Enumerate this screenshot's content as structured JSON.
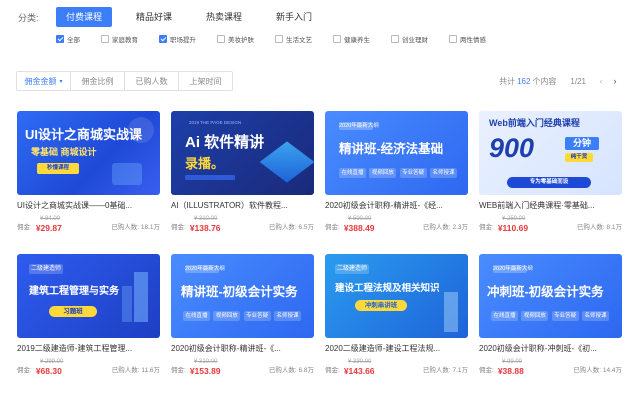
{
  "filters": {
    "category_label": "分类:",
    "tabs": [
      {
        "label": "付费课程",
        "active": true
      },
      {
        "label": "精品好课",
        "active": false
      },
      {
        "label": "热卖课程",
        "active": false
      },
      {
        "label": "新手入门",
        "active": false
      }
    ],
    "subcategories": [
      {
        "label": "全部",
        "checked": true
      },
      {
        "label": "家庭教育",
        "checked": false
      },
      {
        "label": "职场提升",
        "checked": true
      },
      {
        "label": "美妆护肤",
        "checked": false
      },
      {
        "label": "生活文艺",
        "checked": false
      },
      {
        "label": "健康养生",
        "checked": false
      },
      {
        "label": "创业理财",
        "checked": false
      },
      {
        "label": "两性情感",
        "checked": false
      }
    ]
  },
  "sort": {
    "options": [
      {
        "label": "佣金金额",
        "arrow": "▾",
        "active": true
      },
      {
        "label": "佣金比例",
        "arrow": "",
        "active": false
      },
      {
        "label": "已购人数",
        "arrow": "",
        "active": false
      },
      {
        "label": "上架时间",
        "arrow": "",
        "active": false
      }
    ],
    "total_prefix": "共计",
    "total_count": "162",
    "total_suffix": "个内容",
    "page": "1/21",
    "prev_icon": "‹",
    "next_icon": "›"
  },
  "labels": {
    "commission": "佣金:",
    "buyers_prefix": "已购人数:"
  },
  "cards": [
    {
      "title": "UI设计之商城实战课——0基础...",
      "orig_price": "¥ 84.00",
      "commission": "¥29.87",
      "buyers": "18.1万",
      "thumb": {
        "line1": "UI设计之商城实战课",
        "line2": "零基础 商城设计",
        "badge": "秒懂课程"
      }
    },
    {
      "title": "AI（ILLUSTRATOR）软件教程...",
      "orig_price": "¥ 310.00",
      "commission": "¥138.76",
      "buyers": "6.5万",
      "thumb": {
        "top": "2019 THE PAGE DESIGN",
        "line1": "Ai 软件精讲",
        "line2": "录播。"
      }
    },
    {
      "title": "2020初级会计职称-精讲班-《经...",
      "orig_price": "¥ 590.00",
      "commission": "¥388.49",
      "buyers": "2.3万",
      "thumb": {
        "top": "2020年最新大纲",
        "line1": "精讲班-经济法基础",
        "chips": [
          "在线直播",
          "视频回放",
          "专业答疑",
          "名师授课"
        ]
      }
    },
    {
      "title": "WEB前端入门经典课程·零基础...",
      "orig_price": "¥ 259.00",
      "commission": "¥110.69",
      "buyers": "8.1万",
      "thumb": {
        "line1": "Web前端入门经典课程",
        "big": "900",
        "big2": "分钟",
        "tag": "纯干货",
        "bar": "专为零基础而设"
      }
    },
    {
      "title": "2019二级建造师-建筑工程管理...",
      "orig_price": "¥ 299.00",
      "commission": "¥68.30",
      "buyers": "11.6万",
      "thumb": {
        "top": "二级建造师",
        "line1": "建筑工程管理与实务",
        "badge": "习题班"
      }
    },
    {
      "title": "2020初级会计职称-精讲班-《...",
      "orig_price": "¥ 310.00",
      "commission": "¥153.89",
      "buyers": "6.8万",
      "thumb": {
        "top": "2020年最新大纲",
        "line1": "精讲班-初级会计实务",
        "chips": [
          "在线直播",
          "视频回放",
          "专业答疑",
          "名师授课"
        ]
      }
    },
    {
      "title": "2020二级建造师-建设工程法规...",
      "orig_price": "¥ 330.00",
      "commission": "¥143.66",
      "buyers": "7.1万",
      "thumb": {
        "top": "二级建造师",
        "line1": "建设工程法规及相关知识",
        "badge": "冲刺串讲班"
      }
    },
    {
      "title": "2020初级会计职称-冲刺班-《初...",
      "orig_price": "¥ 99.00",
      "commission": "¥38.88",
      "buyers": "14.4万",
      "thumb": {
        "top": "2020年最新大纲",
        "line1": "冲刺班-初级会计实务",
        "chips": [
          "在线直播",
          "视频回放",
          "专业答疑",
          "名师授课"
        ]
      }
    }
  ]
}
